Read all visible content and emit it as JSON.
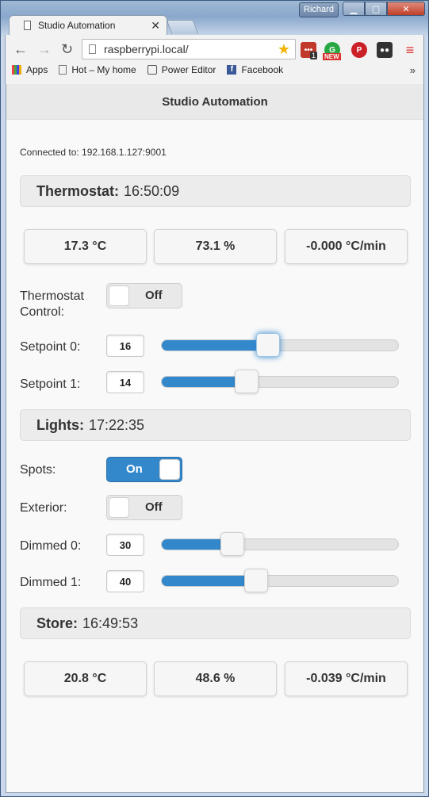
{
  "browser": {
    "user_name": "Richard",
    "tab_title": "Studio Automation",
    "url": "raspberrypi.local/",
    "ext_badge": "1",
    "ext_new": "NEW",
    "bookmarks": [
      {
        "label": "Apps",
        "icon": "apps-grid-icon"
      },
      {
        "label": "Hot – My home",
        "icon": "page-icon"
      },
      {
        "label": "Power Editor",
        "icon": "power-editor-icon"
      },
      {
        "label": "Facebook",
        "icon": "facebook-icon"
      }
    ],
    "more": "»"
  },
  "page": {
    "title": "Studio Automation",
    "connection": "Connected to: 192.168.1.127:9001"
  },
  "thermostat": {
    "label": "Thermostat:",
    "time": "16:50:09",
    "readouts": [
      "17.3 °C",
      "73.1 %",
      "-0.000 °C/min"
    ],
    "control_label_1": "Thermostat",
    "control_label_2": "Control:",
    "control_state": "Off",
    "setpoints": [
      {
        "label": "Setpoint 0:",
        "value": "16",
        "fraction": 0.45
      },
      {
        "label": "Setpoint 1:",
        "value": "14",
        "fraction": 0.36
      }
    ]
  },
  "lights": {
    "label": "Lights:",
    "time": "17:22:35",
    "spots_label": "Spots:",
    "spots_state": "On",
    "exterior_label": "Exterior:",
    "exterior_state": "Off",
    "dimmers": [
      {
        "label": "Dimmed 0:",
        "value": "30",
        "fraction": 0.3
      },
      {
        "label": "Dimmed 1:",
        "value": "40",
        "fraction": 0.4
      }
    ]
  },
  "store": {
    "label": "Store:",
    "time": "16:49:53",
    "readouts": [
      "20.8 °C",
      "48.6 %",
      "-0.039 °C/min"
    ]
  },
  "colors": {
    "accent": "#3388cc",
    "section_bg": "#ececec",
    "page_bg": "#f9f9f9"
  }
}
